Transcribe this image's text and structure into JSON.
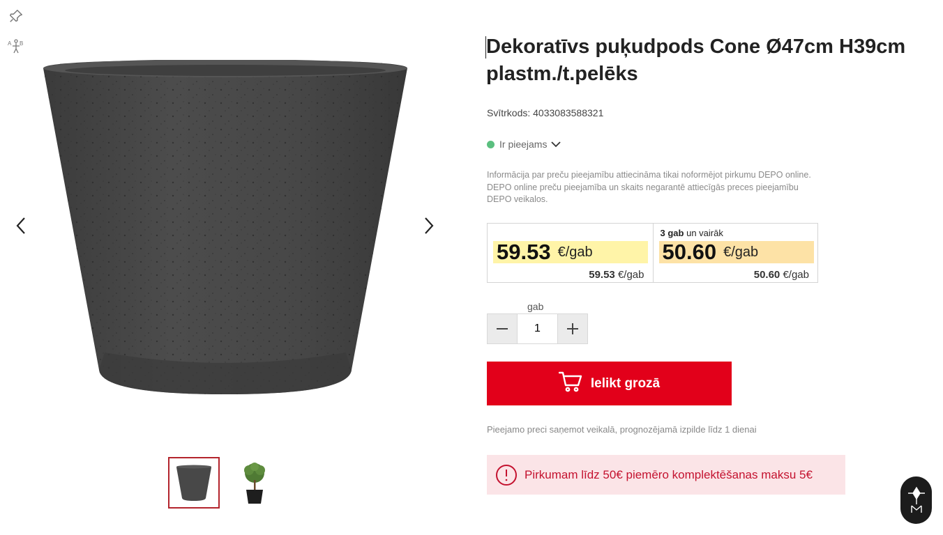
{
  "product": {
    "title": "Dekoratīvs puķudpods Cone Ø47cm H39cm plastm./t.pelēks",
    "barcode_label": "Svītrkods:",
    "barcode_value": "4033083588321"
  },
  "availability": {
    "status": "Ir pieejams",
    "info": "Informācija par preču pieejamību attiecināma tikai noformējot pirkumu DEPO online. DEPO online preču pieejamība  un skaits negarantē attiecīgās preces pieejamību DEPO veikalos."
  },
  "prices": {
    "regular": {
      "price": "59.53",
      "unit": "€/gab",
      "unit_price": "59.53",
      "unit_price_unit": "€/gab"
    },
    "bulk": {
      "qty_bold": "3 gab",
      "qty_rest": "un vairāk",
      "price": "50.60",
      "unit": "€/gab",
      "unit_price": "50.60",
      "unit_price_unit": "€/gab"
    }
  },
  "quantity": {
    "label": "gab",
    "value": "1"
  },
  "cart": {
    "button_label": "Ielikt grozā"
  },
  "fulfilment_note": "Pieejamo preci saņemot veikalā, prognozējamā izpilde līdz 1 dienai",
  "notice": "Pirkumam līdz 50€ piemēro komplektēšanas maksu 5€",
  "colors": {
    "accent_red": "#e2001a",
    "price_highlight_regular": "#fff4a8",
    "price_highlight_bulk": "#fde2a6",
    "available_green": "#5bbf7f",
    "notice_bg": "#fbe4e7"
  },
  "icons": [
    "pin-icon",
    "translate-icon",
    "chevron-left-icon",
    "chevron-right-icon",
    "chevron-down-icon",
    "minus-icon",
    "plus-icon",
    "cart-icon",
    "alert-icon",
    "assistant-icon"
  ]
}
